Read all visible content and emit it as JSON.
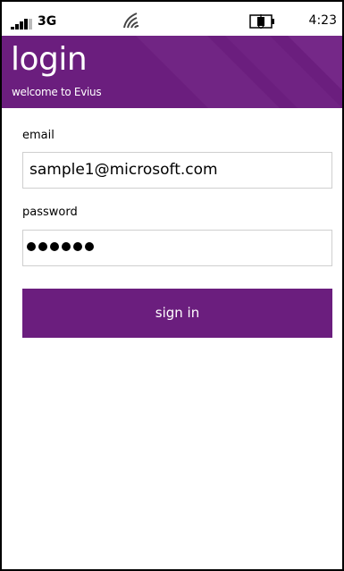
{
  "status_bar": {
    "network": "3G",
    "time": "4:23",
    "icons": [
      "signal-strength-icon",
      "wifi-icon",
      "battery-charging-icon"
    ]
  },
  "header": {
    "title": "login",
    "subtitle": "welcome to Evius"
  },
  "form": {
    "email_label": "email",
    "email_value": "sample1@microsoft.com",
    "password_label": "password",
    "password_length": 6,
    "sign_in_label": "sign in"
  },
  "colors": {
    "accent": "#6b1e7e",
    "field_border": "#cfcfcf"
  }
}
